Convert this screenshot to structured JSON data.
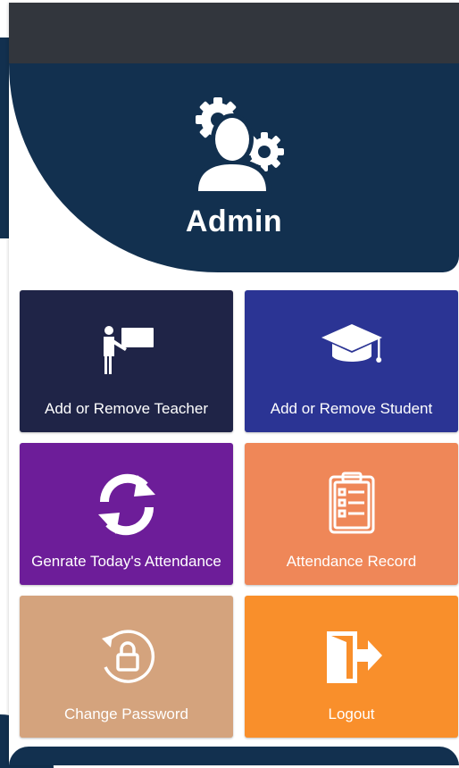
{
  "header": {
    "title": "Admin",
    "icon": "admin-settings-icon"
  },
  "tiles": [
    {
      "label": "Add or Remove Teacher",
      "color": "#1f2447",
      "icon": "teacher-board-icon"
    },
    {
      "label": "Add or Remove Student",
      "color": "#2b3494",
      "icon": "graduation-cap-icon"
    },
    {
      "label": "Genrate Today's Attendance",
      "color": "#6d1d99",
      "icon": "refresh-icon"
    },
    {
      "label": "Attendance Record",
      "color": "#ef8758",
      "icon": "clipboard-list-icon"
    },
    {
      "label": "Change Password",
      "color": "#d4a37d",
      "icon": "lock-reset-icon"
    },
    {
      "label": "Logout",
      "color": "#f98f2b",
      "icon": "exit-door-icon"
    }
  ],
  "colors": {
    "header": "#12304f",
    "status_bar": "#32363d"
  }
}
